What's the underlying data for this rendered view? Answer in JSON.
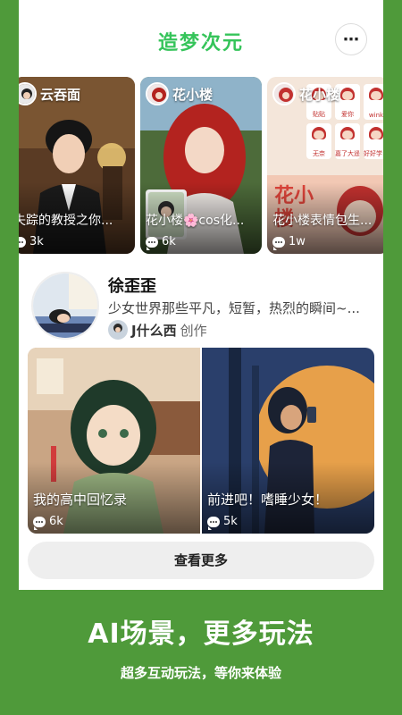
{
  "app": {
    "title": "造梦次元",
    "more_icon": "more-dots-icon"
  },
  "cards": [
    {
      "name": "云吞面",
      "caption": "失踪的教授之你...",
      "count": "3k"
    },
    {
      "name": "花小楼",
      "caption": "花小楼🌸cos化...",
      "count": "6k"
    },
    {
      "name": "花小楼",
      "caption": "花小楼表情包生...",
      "count": "1w",
      "stickers": [
        "贴贴",
        "爱你",
        "wink",
        "无奈",
        "嘉了大遥",
        "好好学习"
      ]
    }
  ],
  "profile": {
    "name": "徐歪歪",
    "description": "少女世界那些平凡，短暂，热烈的瞬间~...",
    "creator": "J什么西",
    "creator_suffix": "创作"
  },
  "stories": [
    {
      "caption": "我的高中回忆录",
      "count": "6k"
    },
    {
      "caption": "前进吧！嗜睡少女！",
      "count": "5k"
    }
  ],
  "see_more": "查看更多",
  "promo": {
    "title": "AI场景，更多玩法",
    "subtitle": "超多互动玩法，等你来体验"
  },
  "colors": {
    "background": "#4f9a3a",
    "accent": "#35c45a"
  }
}
